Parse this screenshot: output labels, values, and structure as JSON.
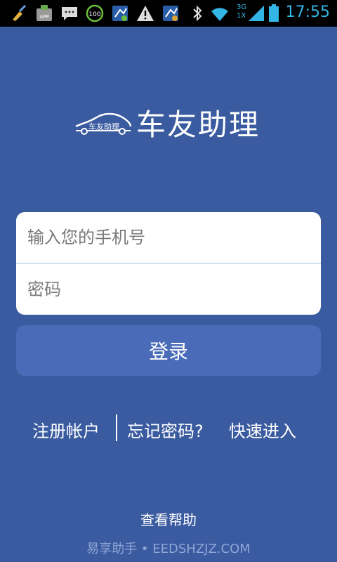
{
  "status_bar": {
    "time": "17:55",
    "network_label_top": "3G",
    "network_label_bottom": "1X",
    "battery_level": 0.85,
    "icons": [
      "broom-icon",
      "app-update-icon",
      "chat-icon",
      "battery-saver-100-icon",
      "sync-upload-icon",
      "warning-icon",
      "sync-settings-icon",
      "bluetooth-icon",
      "wifi-icon",
      "signal-icon",
      "battery-icon"
    ],
    "badge_100": "100",
    "badge_app": "APP"
  },
  "logo": {
    "title": "车友助理",
    "car_badge_text": "车友助理"
  },
  "form": {
    "phone_placeholder": "输入您的手机号",
    "password_placeholder": "密码"
  },
  "login_button": {
    "label": "登录"
  },
  "links": {
    "register": "注册帐户",
    "forgot_password": "忘记密码?",
    "quick_enter": "快速进入"
  },
  "help": {
    "label": "查看帮助"
  },
  "watermark": {
    "text": "易享助手 • EEDSHZJZ.COM"
  },
  "colors": {
    "background": "#3a5ba0",
    "button": "#4a6bb8",
    "status_accent": "#33b5e5"
  }
}
